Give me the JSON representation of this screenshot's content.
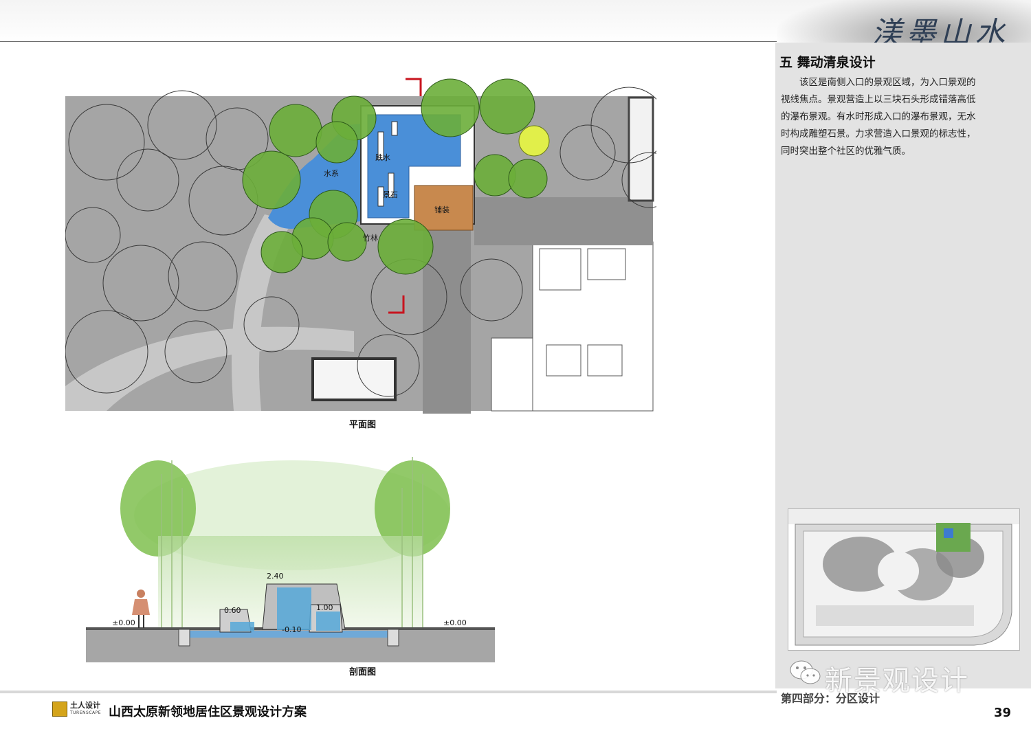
{
  "header": {
    "brand_title": "渼墨山水"
  },
  "section": {
    "title": "五  舞动清泉设计",
    "description": "该区是南侧入口的景观区域，为入口景观的视线焦点。景观营造上以三块石头形成错落高低的瀑布景观。有水时形成入口的瀑布景观，无水时构成雕塑石景。力求营造入口景观的标志性，同时突出整个社区的优雅气质。"
  },
  "plan": {
    "caption": "平面图",
    "labels": {
      "water_system": "水系",
      "falling_water": "跌水",
      "scenic_stone": "景石",
      "paving": "铺装",
      "bamboo": "竹林"
    }
  },
  "section_drawing": {
    "caption": "剖面图",
    "dimensions": {
      "left_grade": "±0.00",
      "right_grade": "±0.00",
      "low_stone": "0.60",
      "high_stone": "2.40",
      "mid_stone": "1.00",
      "pool": "-0.10"
    }
  },
  "footer": {
    "logo_cn": "土人设计",
    "logo_en": "TURENSCAPE",
    "project_title": "山西太原新领地居住区景观设计方案",
    "part_label": "第四部分：分区设计",
    "page_number": "39",
    "watermark": "新景观设计"
  },
  "colors": {
    "water": "#4a8fd8",
    "tree_canopy": "#6cae3a",
    "paving": "#c8894e",
    "ground_gray": "#a4a4a4",
    "panel_gray": "#e3e3e3",
    "marker_red": "#c8141e"
  }
}
